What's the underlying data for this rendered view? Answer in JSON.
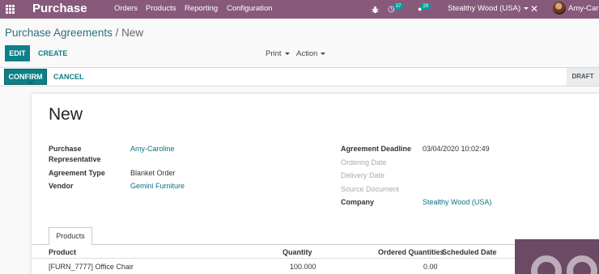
{
  "navbar": {
    "brand": "Purchase",
    "menu": [
      "Orders",
      "Products",
      "Reporting",
      "Configuration"
    ],
    "activity_count": "37",
    "messages_count": "29",
    "company": "Stealthy Wood (USA)",
    "user": "Amy-Caro",
    "bg_color": "#875a7b"
  },
  "breadcrumb": {
    "root": "Purchase Agreements",
    "separator": "/",
    "current": "New"
  },
  "control": {
    "edit": "EDIT",
    "create": "CREATE",
    "print": "Print",
    "action": "Action"
  },
  "status": {
    "confirm": "CONFIRM",
    "cancel": "CANCEL",
    "stage": "DRAFT"
  },
  "form": {
    "title": "New",
    "left": {
      "rep_label_1": "Purchase",
      "rep_label_2": "Representative",
      "rep_value": "Amy-Caroline",
      "type_label": "Agreement Type",
      "type_value": "Blanket Order",
      "vendor_label": "Vendor",
      "vendor_value": "Gemini Furniture"
    },
    "right": {
      "deadline_label": "Agreement Deadline",
      "deadline_value": "03/04/2020 10:02:49",
      "ordering_label": "Ordering Date",
      "delivery_label": "Delivery Date",
      "source_label": "Source Document",
      "company_label": "Company",
      "company_value": "Stealthy Wood (USA)"
    }
  },
  "tabs": {
    "products": "Products"
  },
  "table": {
    "headers": {
      "product": "Product",
      "quantity": "Quantity",
      "ordered": "Ordered Quantities",
      "scheduled": "Scheduled Date"
    },
    "rows": [
      {
        "product": "[FURN_7777] Office Chair",
        "quantity": "100.000",
        "ordered": "0.00"
      }
    ]
  },
  "colors": {
    "accent": "#0d8089",
    "link": "#0d6f83"
  }
}
